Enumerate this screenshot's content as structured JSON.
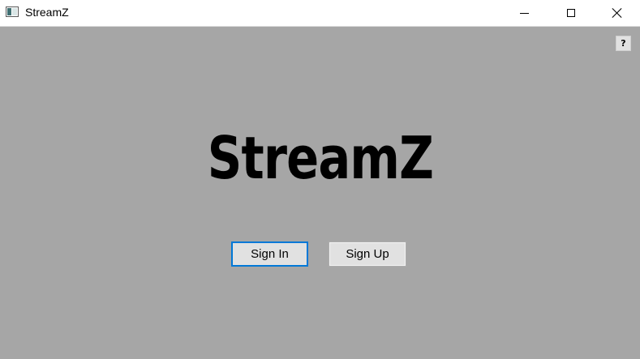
{
  "window": {
    "title": "StreamZ",
    "icon": "app-window-icon",
    "controls": {
      "minimize": "minimize-icon",
      "maximize": "maximize-icon",
      "close": "close-icon"
    },
    "background_color": "#a6a6a6"
  },
  "help": {
    "label": "?"
  },
  "main": {
    "logo_text": "StreamZ",
    "buttons": {
      "sign_in": "Sign In",
      "sign_up": "Sign Up"
    },
    "focus_color": "#0078d7"
  }
}
